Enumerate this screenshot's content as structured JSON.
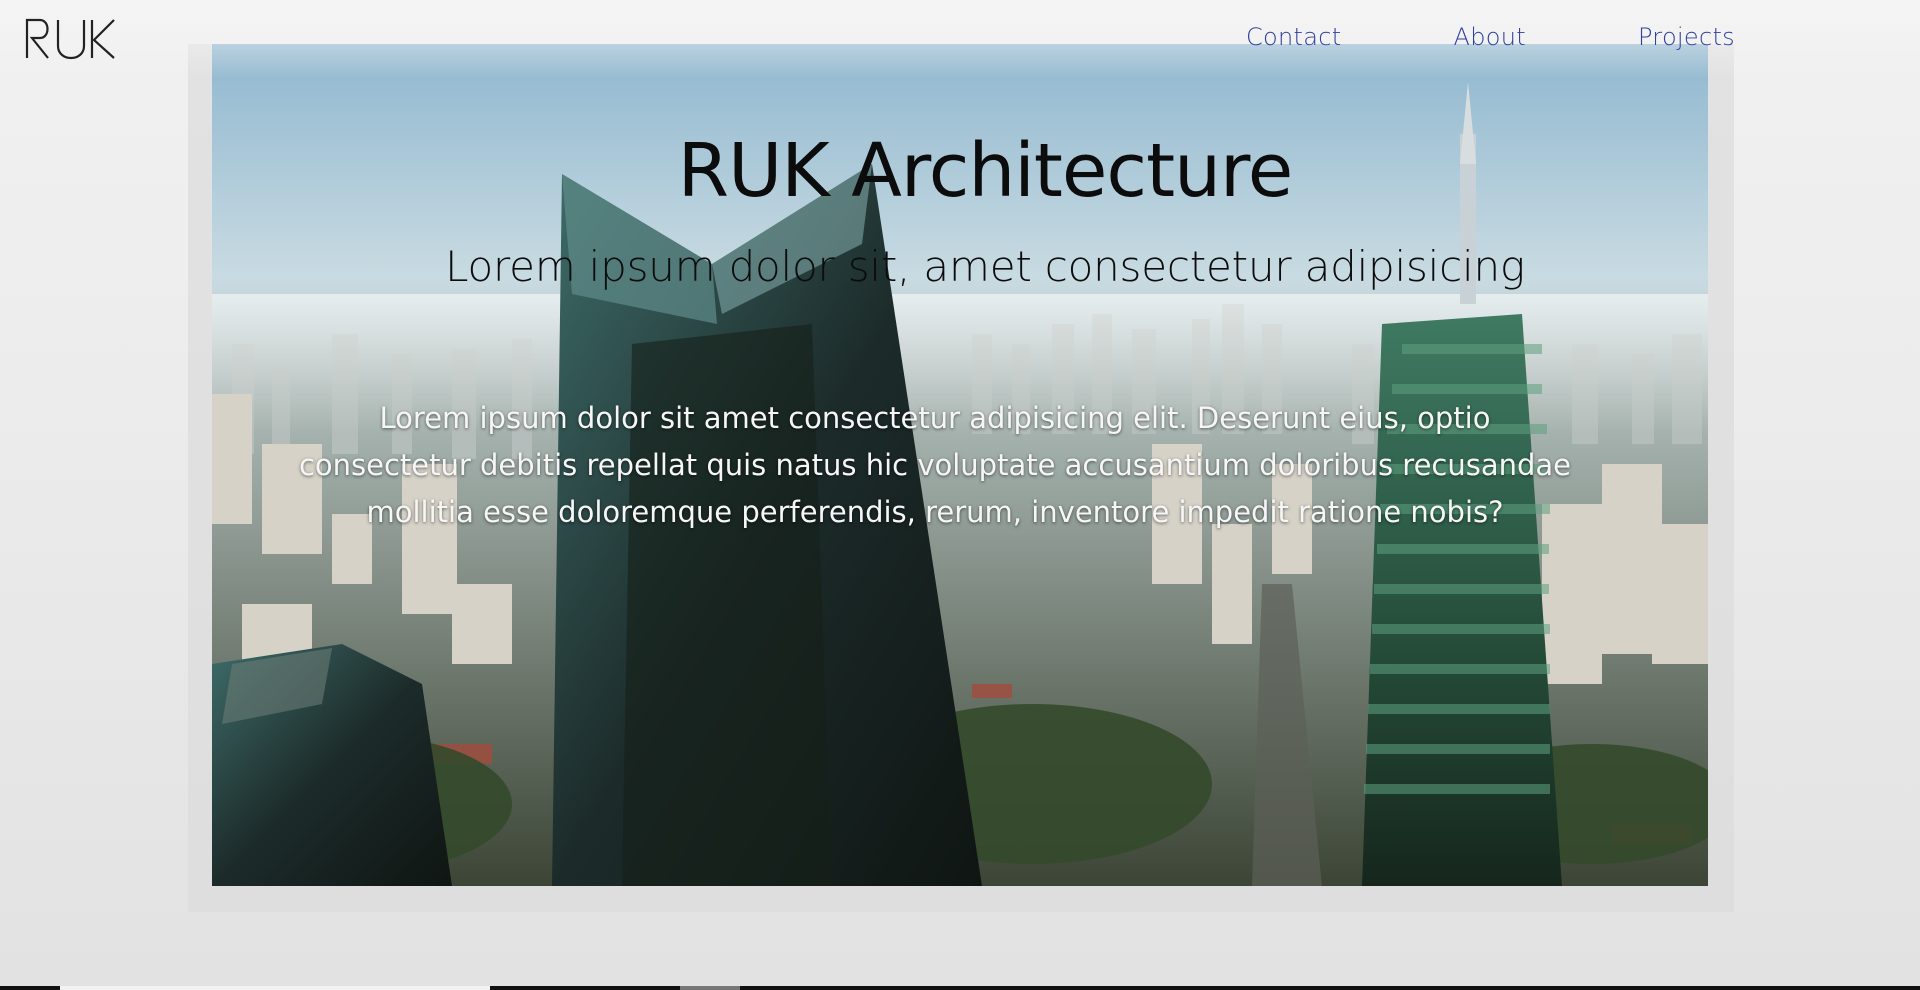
{
  "brand": {
    "logo_text": "RUK"
  },
  "nav": {
    "items": [
      {
        "label": "Contact"
      },
      {
        "label": "About"
      },
      {
        "label": "Projects"
      }
    ]
  },
  "hero": {
    "title": "RUK Architecture",
    "subtitle": "Lorem ipsum dolor sit, amet consectetur adipisicing",
    "body": "Lorem ipsum dolor sit amet consectetur adipisicing elit. Deserunt eius, optio consectetur debitis repellat quis natus hic voluptate accusantium doloribus recusandae mollitia esse doloremque perferendis, rerum, inventore impedit ratione nobis?"
  },
  "colors": {
    "nav_link": "#2e3f9e",
    "heading": "#0c0c0c",
    "body_text": "#f6f6f6",
    "page_bg": "#ececec"
  },
  "icons": [
    "ruk-logo-icon"
  ]
}
